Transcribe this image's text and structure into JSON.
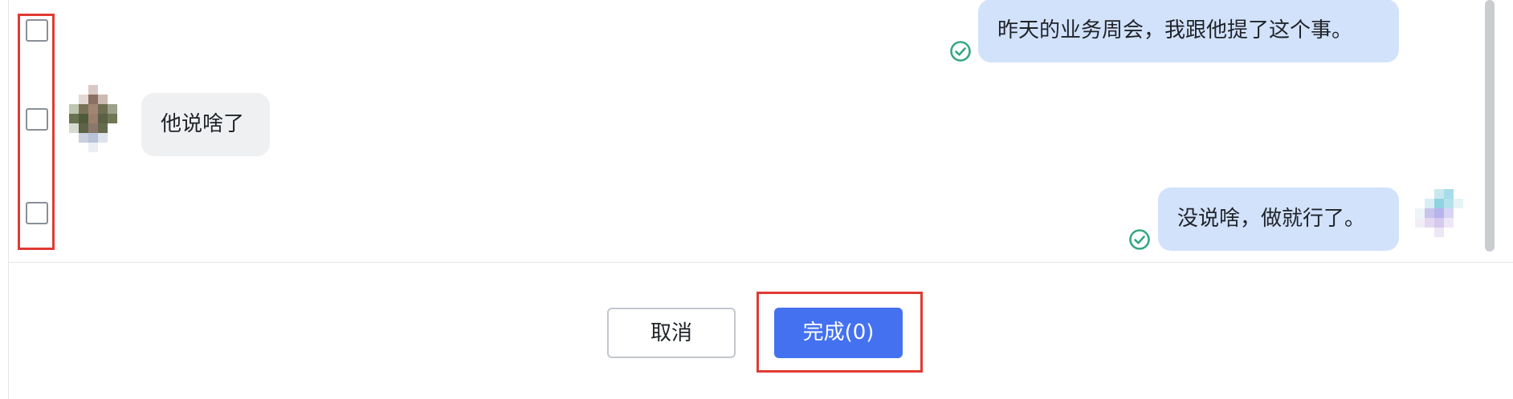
{
  "messages": [
    {
      "side": "right",
      "text": "昨天的业务周会，我跟他提了这个事。",
      "status": "sent-check-icon"
    },
    {
      "side": "left",
      "text": "他说啥了"
    },
    {
      "side": "right",
      "text": "没说啥，做就行了。",
      "status": "sent-check-icon"
    }
  ],
  "footer": {
    "cancel_label": "取消",
    "done_label": "完成(0)"
  },
  "colors": {
    "outgoing_bubble": "#d2e2fb",
    "incoming_bubble": "#eff0f2",
    "primary_button": "#4471f0",
    "check_icon": "#35a87f",
    "highlight": "#e03a33"
  }
}
